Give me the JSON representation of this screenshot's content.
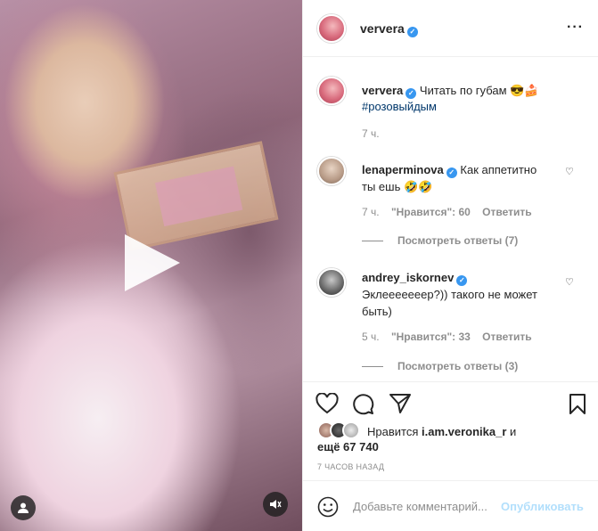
{
  "post": {
    "username": "ververa",
    "caption_user": "ververa",
    "caption_text": "Читать по губам 😎🍰",
    "caption_hashtag": "#розовыйдым",
    "caption_time": "7 ч.",
    "more_icon": "more-horizontal-icon"
  },
  "comments": [
    {
      "username": "lenaperminova",
      "text_line1": "Как аппетитно",
      "text_line2": "ты ешь 🤣🤣",
      "time": "7 ч.",
      "likes": "\"Нравится\": 60",
      "reply": "Ответить",
      "view_replies": "Посмотреть ответы (7)"
    },
    {
      "username": "andrey_iskornev",
      "text_line1": "Эклееееееер?)) такого не может",
      "text_line2": "быть)",
      "time": "5 ч.",
      "likes": "\"Нравится\": 33",
      "reply": "Ответить",
      "view_replies": "Посмотреть ответы (3)"
    }
  ],
  "likes": {
    "prefix": "Нравится",
    "user": "i.am.veronika_r",
    "conj": "и",
    "more": "ещё 67 740"
  },
  "timestamp": "7 ЧАСОВ НАЗАД",
  "comment_box": {
    "placeholder": "Добавьте комментарий...",
    "submit": "Опубликовать"
  },
  "colors": {
    "verified": "#3897f0",
    "publish": "#b2dffc",
    "text": "#262626",
    "muted": "#8e8e8e"
  }
}
